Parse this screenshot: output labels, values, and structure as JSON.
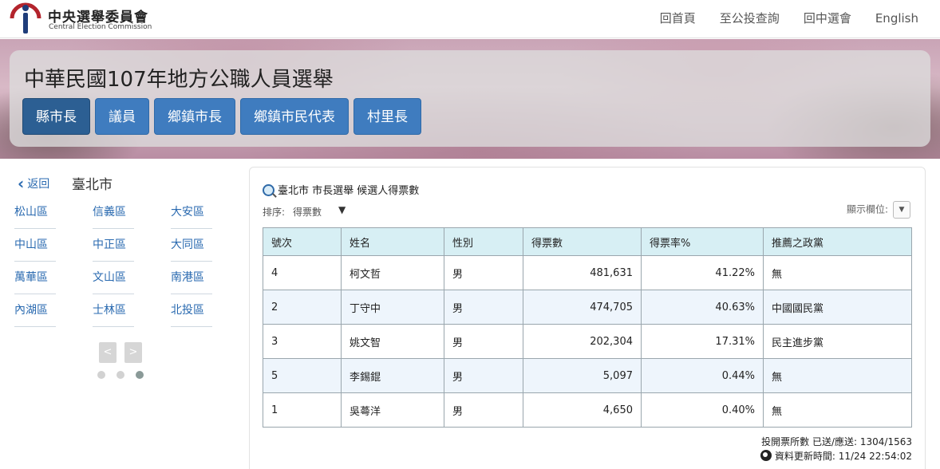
{
  "header": {
    "logo_cn": "中央選舉委員會",
    "logo_en": "Central Election Commission",
    "nav": [
      "回首頁",
      "至公投查詢",
      "回中選會",
      "English"
    ]
  },
  "banner": {
    "title": "中華民國107年地方公職人員選舉",
    "tabs": [
      "縣市長",
      "議員",
      "鄉鎮市長",
      "鄉鎮市民代表",
      "村里長"
    ],
    "active_tab": 0
  },
  "sidebar": {
    "back_label": "返回",
    "city": "臺北市",
    "districts": [
      "松山區",
      "信義區",
      "大安區",
      "中山區",
      "中正區",
      "大同區",
      "萬華區",
      "文山區",
      "南港區",
      "內湖區",
      "士林區",
      "北投區"
    ],
    "pager_prev": "<",
    "pager_next": ">",
    "page_count": 3,
    "current_page": 3
  },
  "main": {
    "title": "臺北市 市長選舉 候選人得票數",
    "sort_label": "排序:",
    "sort_value": "得票數",
    "columns_label": "顯示欄位:",
    "table": {
      "headers": [
        "號次",
        "姓名",
        "性別",
        "得票數",
        "得票率%",
        "推薦之政黨"
      ],
      "rows": [
        [
          "4",
          "柯文哲",
          "男",
          "481,631",
          "41.22%",
          "無"
        ],
        [
          "2",
          "丁守中",
          "男",
          "474,705",
          "40.63%",
          "中國國民黨"
        ],
        [
          "3",
          "姚文智",
          "男",
          "202,304",
          "17.31%",
          "民主進步黨"
        ],
        [
          "5",
          "李錫錕",
          "男",
          "5,097",
          "0.44%",
          "無"
        ],
        [
          "1",
          "吳蕚洋",
          "男",
          "4,650",
          "0.40%",
          "無"
        ]
      ]
    },
    "stations": "投開票所數 已送/應送: 1304/1563",
    "updated": "資料更新時間: 11/24 22:54:02"
  },
  "colors": {
    "tab": "#3f7cbf",
    "tab_active": "#2c5f93",
    "link": "#2a6ab0",
    "table_header": "#d7eff4",
    "row_alt": "#eef5fc"
  }
}
